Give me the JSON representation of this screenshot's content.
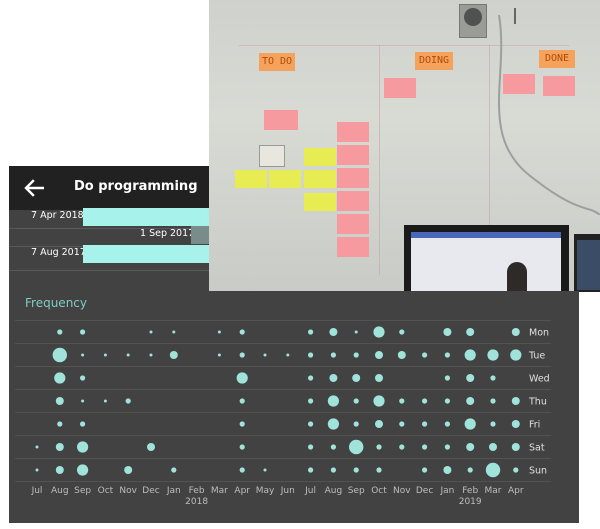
{
  "app": {
    "title": "Do programming",
    "back_icon": "arrow-left-icon"
  },
  "history": [
    {
      "label": "7 Apr 2018",
      "bar_color": "#a7f3ec",
      "label_align": "left"
    },
    {
      "label": "1 Sep 2017",
      "bar_color": "#7a8c89",
      "label_align": "right"
    },
    {
      "label": "7 Aug 2017",
      "bar_color": "#a7f3ec",
      "label_align": "left"
    }
  ],
  "whiteboard": {
    "headers": [
      "TO DO",
      "DOING",
      "DONE"
    ]
  },
  "frequency": {
    "title": "Frequency",
    "dot_color": "#9fe3db",
    "background": "#424242",
    "weekdays": [
      "Mon",
      "Tue",
      "Wed",
      "Thu",
      "Fri",
      "Sat",
      "Sun"
    ],
    "months": [
      "Jul",
      "Aug",
      "Sep",
      "Oct",
      "Nov",
      "Dec",
      "Jan",
      "Feb",
      "Mar",
      "Apr",
      "May",
      "Jun",
      "Jul",
      "Aug",
      "Sep",
      "Oct",
      "Nov",
      "Dec",
      "Jan",
      "Feb",
      "Mar",
      "Apr"
    ],
    "years": [
      {
        "label": "2018",
        "month_index": 7
      },
      {
        "label": "2019",
        "month_index": 19
      }
    ],
    "sizes": [
      [
        0,
        2,
        2,
        0,
        0,
        1,
        1,
        0,
        1,
        2,
        0,
        0,
        2,
        3,
        1,
        4,
        2,
        0,
        3,
        3,
        0,
        3
      ],
      [
        0,
        5,
        1,
        1,
        1,
        1,
        3,
        0,
        1,
        2,
        1,
        1,
        2,
        2,
        2,
        3,
        3,
        2,
        2,
        4,
        4,
        4
      ],
      [
        0,
        4,
        2,
        0,
        0,
        0,
        0,
        0,
        0,
        4,
        0,
        0,
        2,
        3,
        3,
        3,
        0,
        0,
        2,
        3,
        2,
        0
      ],
      [
        0,
        3,
        1,
        1,
        2,
        0,
        0,
        0,
        0,
        2,
        0,
        0,
        2,
        4,
        2,
        4,
        2,
        2,
        2,
        3,
        2,
        3
      ],
      [
        0,
        2,
        2,
        0,
        0,
        0,
        0,
        0,
        0,
        2,
        0,
        0,
        2,
        4,
        2,
        3,
        2,
        2,
        2,
        4,
        2,
        3
      ],
      [
        1,
        3,
        4,
        0,
        0,
        3,
        0,
        0,
        0,
        2,
        0,
        0,
        2,
        2,
        5,
        2,
        2,
        2,
        2,
        3,
        3,
        3
      ],
      [
        1,
        3,
        4,
        0,
        3,
        0,
        2,
        0,
        0,
        2,
        1,
        0,
        2,
        2,
        2,
        2,
        0,
        2,
        3,
        2,
        5,
        2
      ]
    ]
  }
}
